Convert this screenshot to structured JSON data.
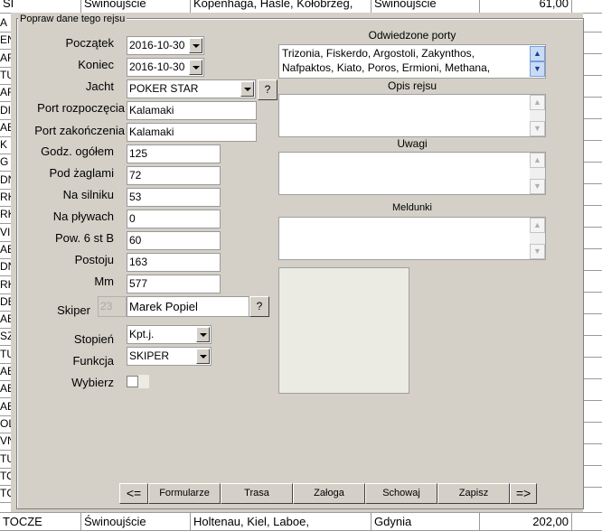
{
  "background_grid": {
    "top_row": [
      "SI",
      "Świnoujście",
      "Kopenhaga, Hasle, Kołobrzeg,",
      "Świnoujście",
      "61,00"
    ],
    "bottom_row": [
      "TOCZE",
      "Świnoujście",
      "Holtenau, Kiel, Laboe,",
      "Gdynia",
      "202,00"
    ],
    "left_fragments": [
      "A",
      "EN",
      "AF",
      "TU",
      "AF",
      "DI",
      "AB",
      "K N",
      "G",
      "DN",
      "RK",
      "RK",
      "VIS",
      "AB",
      "DN",
      "RK",
      "DE",
      "AB",
      "SZ",
      "TU",
      "AB",
      "AB",
      "AB",
      "OL",
      "VN",
      "TU",
      "TO",
      "TC"
    ]
  },
  "dialog": {
    "title": "Popraw dane tego rejsu",
    "labels": {
      "start": "Początek",
      "end": "Koniec",
      "yacht": "Jacht",
      "port_start": "Port rozpoczęcia",
      "port_end": "Port zakończenia",
      "hours_total": "Godz. ogółem",
      "under_sail": "Pod żaglami",
      "engine": "Na silniku",
      "in_port": "Na pływach",
      "above_6b": "Pow. 6 st B",
      "stopped": "Postoju",
      "miles": "Mm",
      "skipper": "Skiper",
      "rank": "Stopień",
      "function": "Funkcja",
      "select": "Wybierz"
    },
    "values": {
      "start": "2016-10-30",
      "end": "2016-10-30",
      "yacht": "POKER STAR",
      "port_start": "Kalamaki",
      "port_end": "Kalamaki",
      "hours_total": "125",
      "under_sail": "72",
      "engine": "53",
      "in_port": "0",
      "above_6b": "60",
      "stopped": "163",
      "miles": "577",
      "skipper_id": "23",
      "skipper_name": "Marek Popiel",
      "rank": "Kpt.j.",
      "function": "SKIPER"
    },
    "help_label": "?",
    "sections": {
      "visited_ports": "Odwiedzone porty",
      "visited_ports_text_1": "Trizonia, Fiskerdo, Argostoli, Zakynthos,",
      "visited_ports_text_2": "Nafpaktos, Kiato, Poros, Ermioni, Methana,",
      "description": "Opis rejsu",
      "remarks": "Uwagi",
      "reports": "Meldunki"
    },
    "buttons": {
      "prev": "<=",
      "forms": "Formularze",
      "route": "Trasa",
      "crew": "Załoga",
      "hide": "Schowaj",
      "save": "Zapisz",
      "next": "=>"
    }
  }
}
